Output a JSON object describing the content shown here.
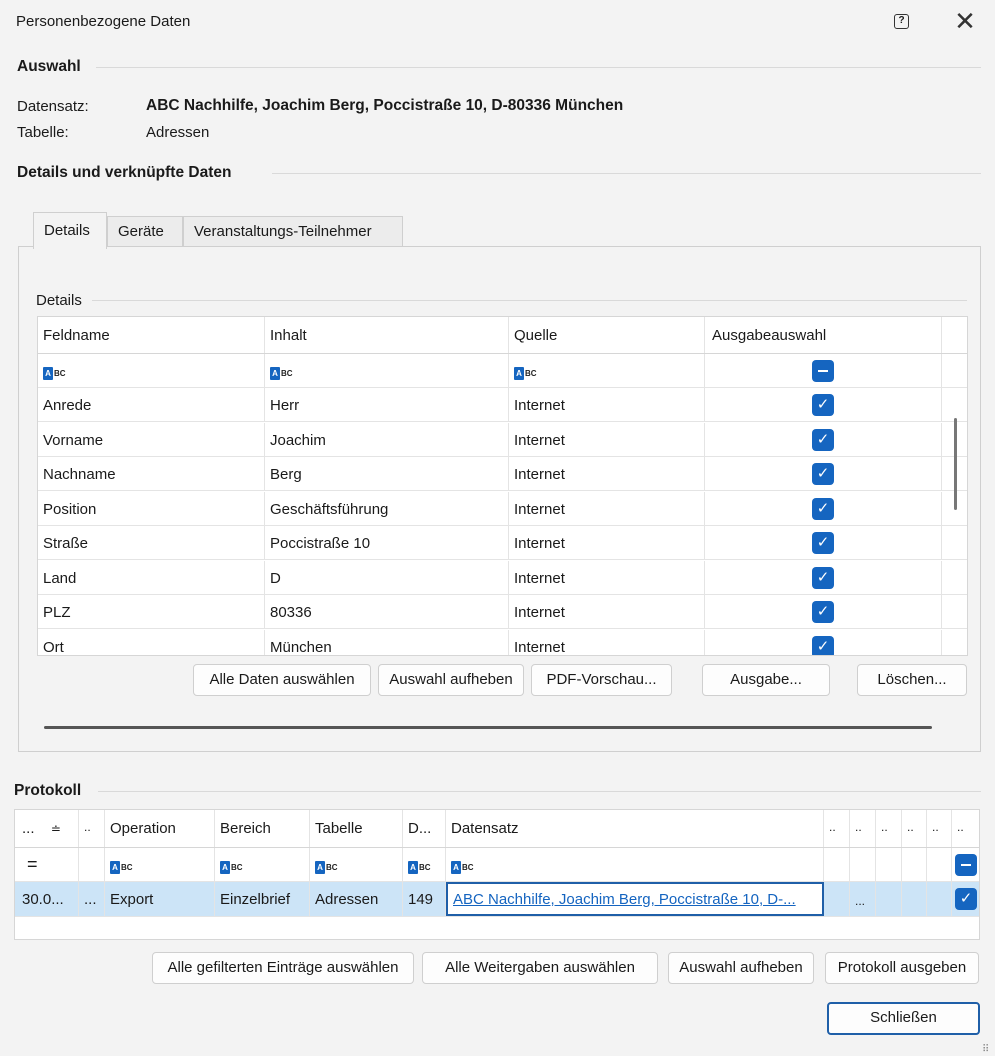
{
  "window": {
    "title": "Personenbezogene Daten",
    "help_glyph": "?",
    "close_glyph": "✕"
  },
  "auswahl": {
    "heading": "Auswahl",
    "datensatz_label": "Datensatz:",
    "datensatz_value": "ABC Nachhilfe, Joachim Berg, Poccistraße 10, D-80336 München",
    "tabelle_label": "Tabelle:",
    "tabelle_value": "Adressen"
  },
  "details_section": {
    "heading": "Details und verknüpfte Daten"
  },
  "tabs": [
    {
      "label": "Details",
      "active": true
    },
    {
      "label": "Geräte",
      "active": false
    },
    {
      "label": "Veranstaltungs-Teilnehmer",
      "active": false
    }
  ],
  "details_group": {
    "label": "Details",
    "columns": [
      "Feldname",
      "Inhalt",
      "Quelle",
      "Ausgabeauswahl"
    ],
    "filter_icon": "abc-filter-icon",
    "rows": [
      {
        "feldname": "Anrede",
        "inhalt": "Herr",
        "quelle": "Internet",
        "checked": true
      },
      {
        "feldname": "Vorname",
        "inhalt": "Joachim",
        "quelle": "Internet",
        "checked": true
      },
      {
        "feldname": "Nachname",
        "inhalt": "Berg",
        "quelle": "Internet",
        "checked": true
      },
      {
        "feldname": "Position",
        "inhalt": "Geschäftsführung",
        "quelle": "Internet",
        "checked": true
      },
      {
        "feldname": "Straße",
        "inhalt": "Poccistraße 10",
        "quelle": "Internet",
        "checked": true
      },
      {
        "feldname": "Land",
        "inhalt": "D",
        "quelle": "Internet",
        "checked": true
      },
      {
        "feldname": "PLZ",
        "inhalt": "80336",
        "quelle": "Internet",
        "checked": true
      },
      {
        "feldname": "Ort",
        "inhalt": "München",
        "quelle": "Internet",
        "checked": true
      }
    ],
    "buttons": {
      "select_all": "Alle Daten auswählen",
      "clear": "Auswahl aufheben",
      "pdf": "PDF-Vorschau...",
      "ausgabe": "Ausgabe...",
      "loeschen": "Löschen..."
    }
  },
  "protokoll": {
    "heading": "Protokoll",
    "columns": [
      "...",
      "..",
      "Operation",
      "Bereich",
      "Tabelle",
      "D...",
      "Datensatz",
      "..",
      "..",
      "..",
      "..",
      "..",
      ".."
    ],
    "filter_equals": "=",
    "row": {
      "date": "30.0...",
      "c2": "...",
      "operation": "Export",
      "bereich": "Einzelbrief",
      "tabelle": "Adressen",
      "d": "149",
      "datensatz": "ABC Nachhilfe, Joachim Berg, Poccistraße 10, D-...",
      "c8": "...",
      "checked": true
    },
    "buttons": {
      "select_filtered": "Alle gefilterten Einträge auswählen",
      "select_shares": "Alle Weitergaben auswählen",
      "clear": "Auswahl aufheben",
      "output": "Protokoll ausgeben"
    }
  },
  "footer": {
    "close_label": "Schließen"
  }
}
